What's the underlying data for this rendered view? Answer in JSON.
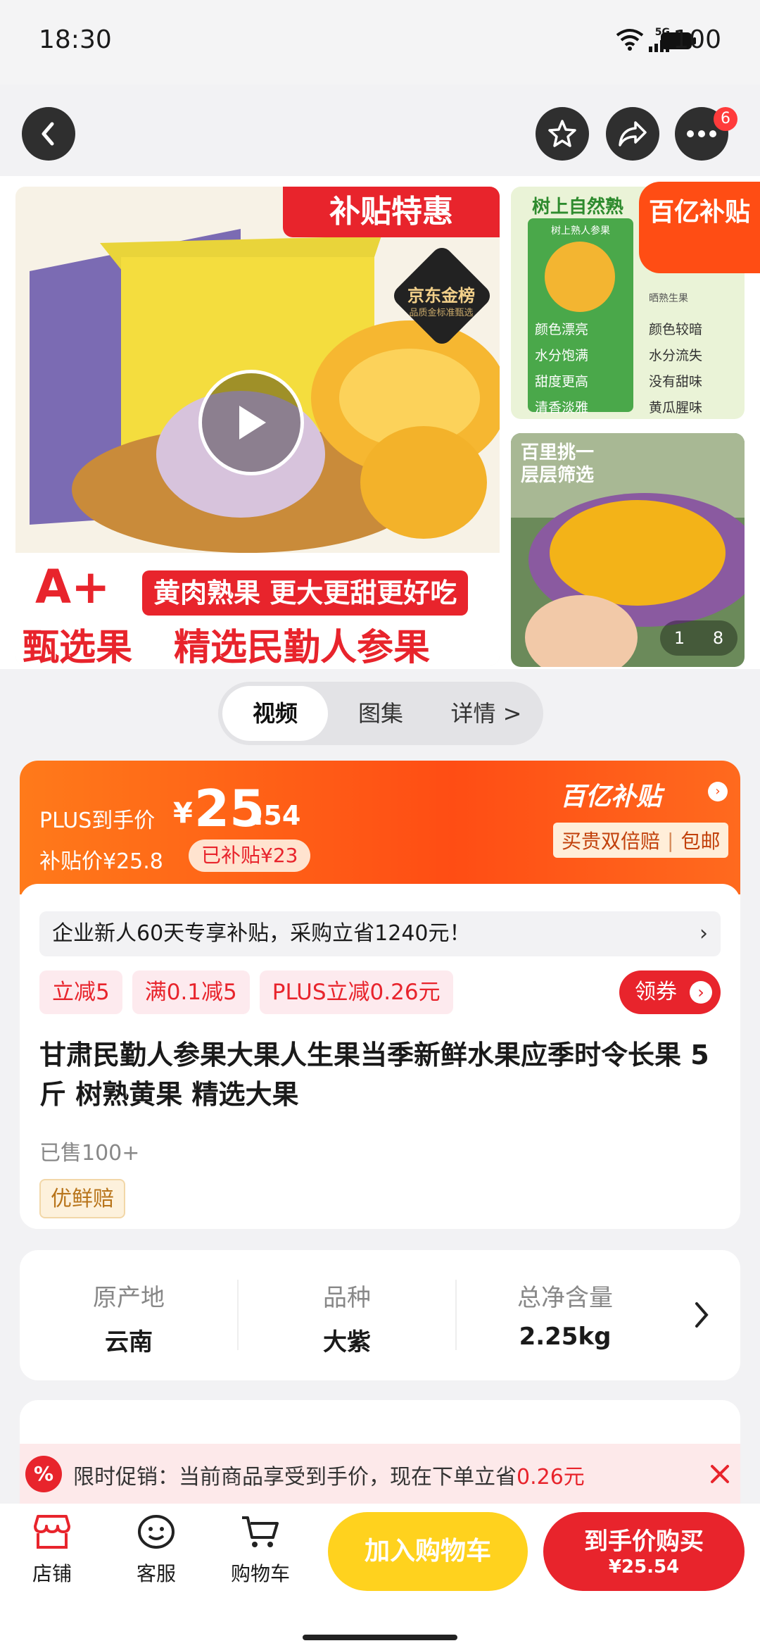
{
  "status_bar": {
    "time": "18:30",
    "battery": "100",
    "network": "5G"
  },
  "nav": {
    "cart_badge": "6"
  },
  "gallery": {
    "main_banner_top": "补贴特惠",
    "main_badge": "京东金榜",
    "main_badge_sub": "品质金标准甄选",
    "main_slogan_1": "黄肉熟果 更大更甜更好吃",
    "main_grade": "A+",
    "main_grade_sub": "甄选果",
    "main_slogan_2": "精选民勤人参果",
    "side1_title": "树上自然熟",
    "side1_corner": "百亿补贴",
    "side1_left_title": "树上熟人参果",
    "side1_right_title": "晒熟生果",
    "side1_pros": [
      "颜色漂亮",
      "水分饱满",
      "甜度更高",
      "清香淡雅"
    ],
    "side1_cons": [
      "颜色较暗",
      "水分流失",
      "没有甜味",
      "黄瓜腥味"
    ],
    "side2_caption": "百里挑一\n层层筛选",
    "counter_current": "1",
    "counter_total": "8"
  },
  "tabs": [
    "视频",
    "图集",
    "详情 >"
  ],
  "price": {
    "plus_label": "PLUS到手价",
    "currency": "¥",
    "int": "25",
    "dec": ".54",
    "subsidy_price_label": "补贴价¥25.8",
    "subsidized": "已补贴¥23",
    "brand": "百亿补贴",
    "guarantee": "买贵双倍赔",
    "shipping": "包邮"
  },
  "info": {
    "new_user_text": "企业新人60天专享补贴，采购立省1240元！",
    "tags": [
      "立减5",
      "满0.1减5",
      "PLUS立减0.26元"
    ],
    "coupon_label": "领券",
    "title": "甘肃民勤人参果大果人生果当季新鲜水果应季时令长果 5斤 树熟黄果 精选大果",
    "sold": "已售100+",
    "badge": "优鲜赔"
  },
  "specs": [
    {
      "label": "原产地",
      "value": "云南"
    },
    {
      "label": "品种",
      "value": "大紫"
    },
    {
      "label": "总净含量",
      "value": "2.25kg"
    }
  ],
  "promo": {
    "prefix": "限时促销：当前商品享受到手价，现在下单立省",
    "amount": "0.26元"
  },
  "bottom": {
    "shop": "店铺",
    "service": "客服",
    "cart": "购物车",
    "add_cart": "加入购物车",
    "buy_label": "到手价购买",
    "buy_price": "¥25.54"
  },
  "colors": {
    "accent": "#ff4d14",
    "red": "#e8242c",
    "yellow": "#ffd21e"
  }
}
